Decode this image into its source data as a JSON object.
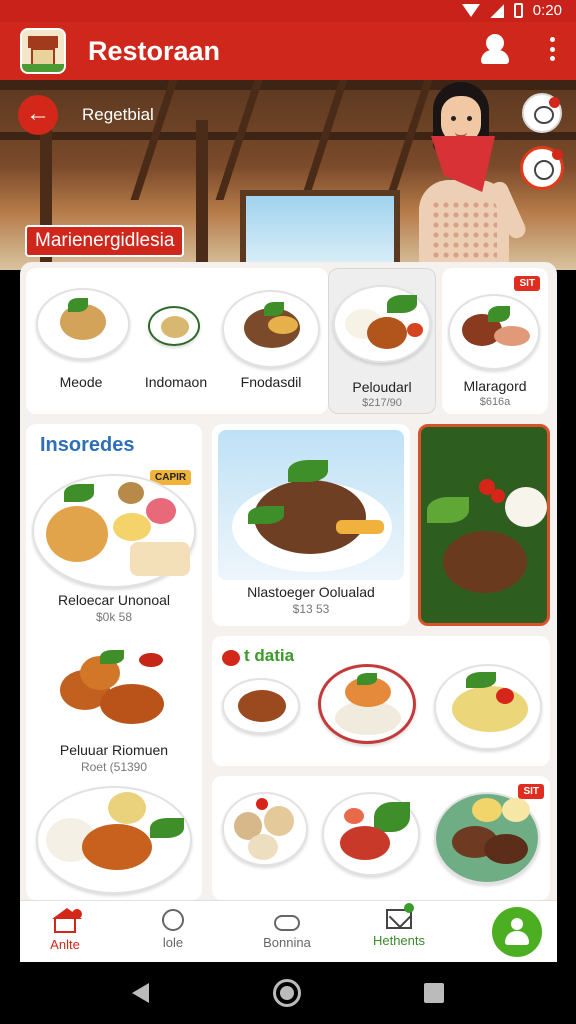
{
  "status_bar": {
    "time": "0:20"
  },
  "app_bar": {
    "title": "Restoraan"
  },
  "hero": {
    "subtitle": "Regetbial",
    "chip": "Marienergidlesia"
  },
  "top_foods": [
    {
      "name": "Meode",
      "price": ""
    },
    {
      "name": "Indomaon",
      "price": ""
    },
    {
      "name": "Fnodasdil",
      "price": ""
    },
    {
      "name": "Peloudarl",
      "price": "$217/90"
    },
    {
      "name": "Mlaragord",
      "price": "$616a",
      "badge": "SIT"
    }
  ],
  "sections": {
    "left": {
      "title": "Insoredes",
      "tag": "CAPIR",
      "items": [
        {
          "name": "Reloecar Unonoal",
          "price": "$0k 58"
        },
        {
          "name": "Peluuar Riomuen",
          "price": "Roet (51390"
        }
      ]
    },
    "featured": {
      "name": "Nlastoeger Oolualad",
      "price": "$13 53"
    },
    "datia": {
      "title": "t datia"
    },
    "bottom_row": {
      "badge": "SIT"
    }
  },
  "bottom_nav": {
    "items": [
      {
        "label": "Anlte"
      },
      {
        "label": "lole"
      },
      {
        "label": "Bonnina"
      },
      {
        "label": "Hethents"
      }
    ]
  },
  "colors": {
    "brand": "#cf271c",
    "accent_green": "#4caf22",
    "section_blue": "#2f6fb7",
    "section_green": "#3a9a2a"
  }
}
